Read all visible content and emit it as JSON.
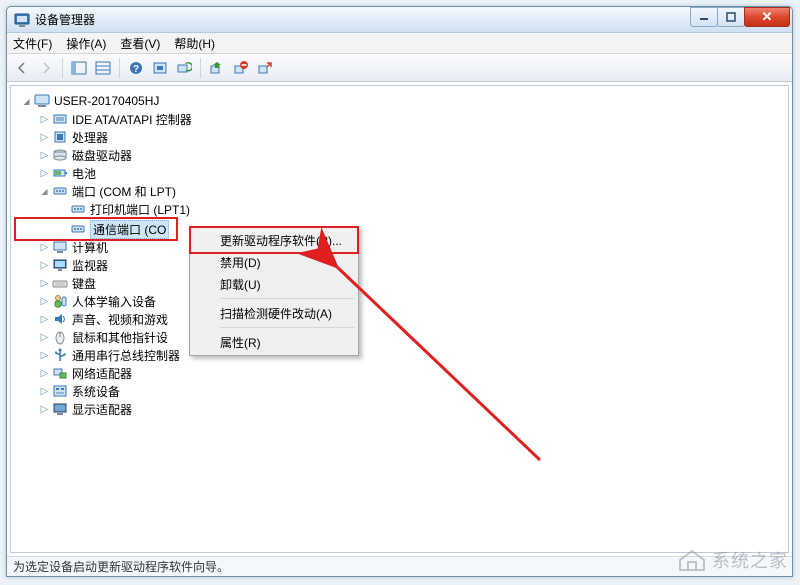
{
  "title": "设备管理器",
  "menu": {
    "file": "文件(F)",
    "action": "操作(A)",
    "view": "查看(V)",
    "help": "帮助(H)"
  },
  "root": "USER-20170405HJ",
  "tree": [
    {
      "label": "IDE ATA/ATAPI 控制器",
      "icon": "ide"
    },
    {
      "label": "处理器",
      "icon": "cpu"
    },
    {
      "label": "磁盘驱动器",
      "icon": "disk"
    },
    {
      "label": "电池",
      "icon": "battery"
    },
    {
      "label": "端口 (COM 和 LPT)",
      "icon": "port",
      "open": true,
      "children": [
        {
          "label": "打印机端口 (LPT1)",
          "icon": "port-item"
        },
        {
          "label": "通信端口 (CO",
          "icon": "port-item",
          "selected": true
        }
      ]
    },
    {
      "label": "计算机",
      "icon": "computer"
    },
    {
      "label": "监视器",
      "icon": "monitor"
    },
    {
      "label": "键盘",
      "icon": "keyboard"
    },
    {
      "label": "人体学输入设备",
      "icon": "hid"
    },
    {
      "label": "声音、视频和游戏",
      "icon": "sound",
      "truncated": true
    },
    {
      "label": "鼠标和其他指针设",
      "icon": "mouse",
      "truncated": true
    },
    {
      "label": "通用串行总线控制器",
      "icon": "usb"
    },
    {
      "label": "网络适配器",
      "icon": "network"
    },
    {
      "label": "系统设备",
      "icon": "system"
    },
    {
      "label": "显示适配器",
      "icon": "display"
    }
  ],
  "contextMenu": {
    "updateDriver": "更新驱动程序软件(P)...",
    "disable": "禁用(D)",
    "uninstall": "卸载(U)",
    "scan": "扫描检测硬件改动(A)",
    "properties": "属性(R)"
  },
  "status": "为选定设备启动更新驱动程序软件向导。",
  "watermark": "系统之家"
}
